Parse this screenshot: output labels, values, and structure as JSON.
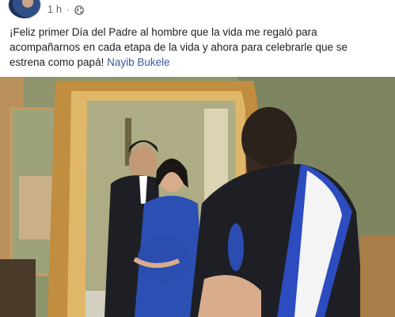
{
  "post": {
    "time": "1 h",
    "separator": "·",
    "privacy_icon": "globe-icon",
    "text": "¡Feliz primer Día del Padre al hombre que la vida me regaló para acompañarnos en cada etapa de la vida y ahora para celebrarle que se estrena como papá!",
    "mention": "Nayib Bukele"
  },
  "colors": {
    "meta_gray": "#65676b",
    "mention_blue": "#385898",
    "text": "#1c1e21"
  }
}
